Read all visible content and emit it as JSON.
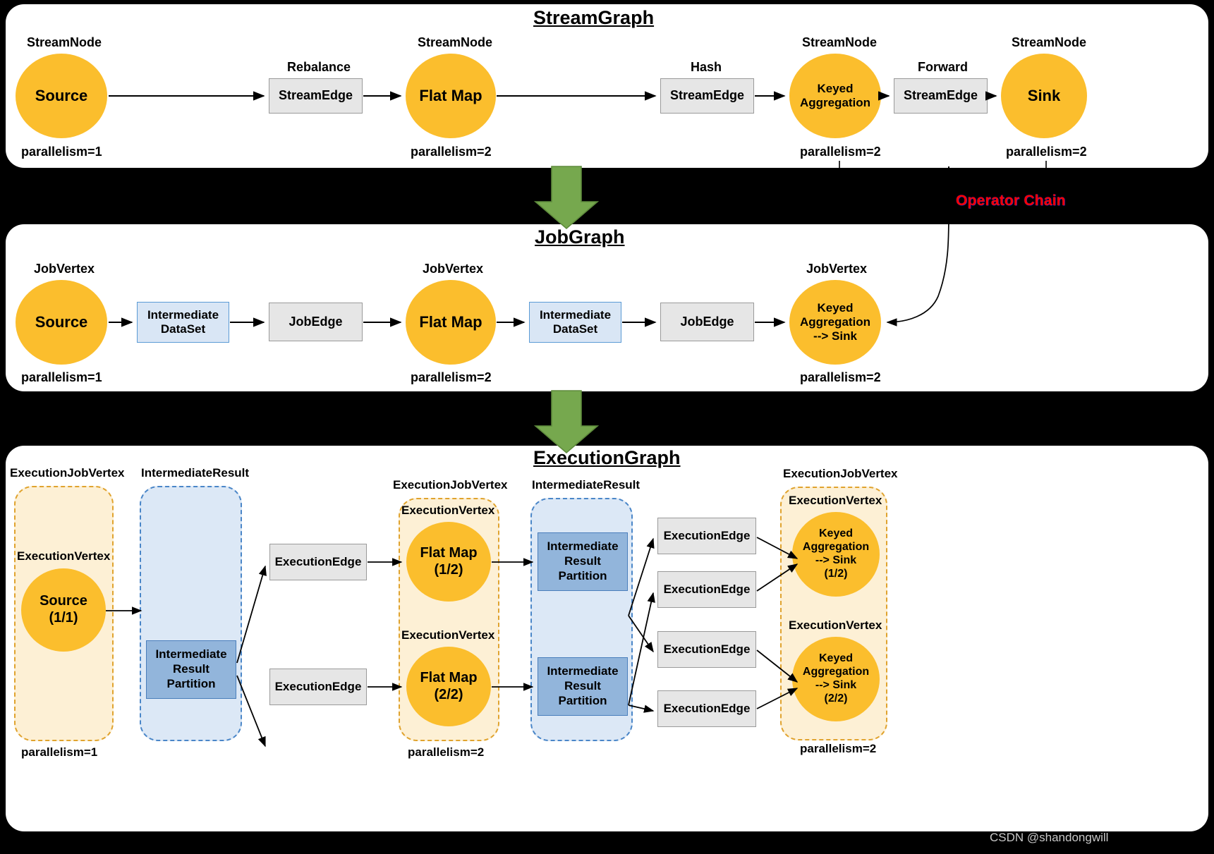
{
  "sections": [
    {
      "id": "streamgraph",
      "title": "StreamGraph"
    },
    {
      "id": "jobgraph",
      "title": "JobGraph"
    },
    {
      "id": "executiongraph",
      "title": "ExecutionGraph"
    }
  ],
  "streamgraph": {
    "title": "StreamGraph",
    "node_type_label": "StreamNode",
    "nodes": [
      {
        "name": "Source",
        "type_label": "StreamNode",
        "parallelism": "parallelism=1"
      },
      {
        "name": "Flat Map",
        "type_label": "StreamNode",
        "parallelism": "parallelism=2"
      },
      {
        "name": "Keyed Aggregation",
        "line1": "Keyed",
        "line2": "Aggregation",
        "type_label": "StreamNode",
        "parallelism": "parallelism=2"
      },
      {
        "name": "Sink",
        "type_label": "StreamNode",
        "parallelism": "parallelism=2"
      }
    ],
    "edges": [
      {
        "label": "StreamEdge",
        "strategy": "Rebalance"
      },
      {
        "label": "StreamEdge",
        "strategy": "Hash"
      },
      {
        "label": "StreamEdge",
        "strategy": "Forward"
      }
    ],
    "operator_chain_label": "Operator Chain"
  },
  "jobgraph": {
    "title": "JobGraph",
    "vertex_type_label": "JobVertex",
    "nodes": [
      {
        "name": "Source",
        "type_label": "JobVertex",
        "parallelism": "parallelism=1"
      },
      {
        "name": "Flat Map",
        "type_label": "JobVertex",
        "parallelism": "parallelism=2"
      },
      {
        "line1": "Keyed",
        "line2": "Aggregation",
        "line3": "--> Sink",
        "type_label": "JobVertex",
        "parallelism": "parallelism=2"
      }
    ],
    "datasets": [
      {
        "line1": "Intermediate",
        "line2": "DataSet"
      },
      {
        "line1": "Intermediate",
        "line2": "DataSet"
      }
    ],
    "edges": [
      {
        "label": "JobEdge"
      },
      {
        "label": "JobEdge"
      }
    ]
  },
  "executiongraph": {
    "title": "ExecutionGraph",
    "job_vertex_label": "ExecutionJobVertex",
    "vertex_label": "ExecutionVertex",
    "intermediate_result_label": "IntermediateResult",
    "groups": [
      {
        "type_label": "ExecutionJobVertex",
        "parallelism": "parallelism=1",
        "vertices": [
          {
            "type_label": "ExecutionVertex",
            "line1": "Source",
            "line2": "(1/1)"
          }
        ]
      },
      {
        "type_label": "ExecutionJobVertex",
        "parallelism": "parallelism=2",
        "vertices": [
          {
            "type_label": "ExecutionVertex",
            "line1": "Flat Map",
            "line2": "(1/2)"
          },
          {
            "type_label": "ExecutionVertex",
            "line1": "Flat Map",
            "line2": "(2/2)"
          }
        ]
      },
      {
        "type_label": "ExecutionJobVertex",
        "parallelism": "parallelism=2",
        "vertices": [
          {
            "type_label": "ExecutionVertex",
            "line1": "Keyed",
            "line2": "Aggregation",
            "line3": "--> Sink",
            "line4": "(1/2)"
          },
          {
            "type_label": "ExecutionVertex",
            "line1": "Keyed",
            "line2": "Aggregation",
            "line3": "--> Sink",
            "line4": "(2/2)"
          }
        ]
      }
    ],
    "intermediate_results": [
      {
        "type_label": "IntermediateResult",
        "partitions": [
          {
            "line1": "Intermediate",
            "line2": "Result",
            "line3": "Partition"
          }
        ]
      },
      {
        "type_label": "IntermediateResult",
        "partitions": [
          {
            "line1": "Intermediate",
            "line2": "Result",
            "line3": "Partition"
          },
          {
            "line1": "Intermediate",
            "line2": "Result",
            "line3": "Partition"
          }
        ]
      }
    ],
    "execution_edges": [
      {
        "label": "ExecutionEdge"
      },
      {
        "label": "ExecutionEdge"
      },
      {
        "label": "ExecutionEdge"
      },
      {
        "label": "ExecutionEdge"
      },
      {
        "label": "ExecutionEdge"
      },
      {
        "label": "ExecutionEdge"
      }
    ]
  },
  "watermark": "CSDN @shandongwill",
  "colors": {
    "node_orange": "#FBBE2D",
    "edge_gray": "#E6E6E6",
    "dataset_blue": "#D9E6F5",
    "partition_blue": "#92B5DB",
    "container_yellow": "#FDF0D5",
    "container_blue": "#DCE8F6",
    "arrow_green": "#76A84E",
    "background": "#000000",
    "panel": "#FFFFFF",
    "operator_chain_red": "#FF0000"
  }
}
